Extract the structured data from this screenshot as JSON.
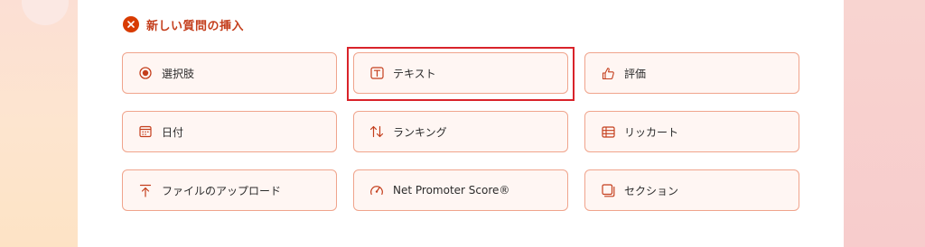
{
  "header": {
    "title": "新しい質問の挿入"
  },
  "options": [
    {
      "label": "選択肢",
      "icon": "radio-choice-icon"
    },
    {
      "label": "テキスト",
      "icon": "text-box-icon"
    },
    {
      "label": "評価",
      "icon": "thumbs-up-icon"
    },
    {
      "label": "日付",
      "icon": "calendar-icon"
    },
    {
      "label": "ランキング",
      "icon": "sort-arrows-icon"
    },
    {
      "label": "リッカート",
      "icon": "likert-grid-icon"
    },
    {
      "label": "ファイルのアップロード",
      "icon": "upload-icon"
    },
    {
      "label": "Net Promoter Score®",
      "icon": "gauge-icon"
    },
    {
      "label": "セクション",
      "icon": "section-icon"
    }
  ],
  "colors": {
    "accent": "#d83b01",
    "title": "#c43e1c",
    "option_border": "#f0a48c",
    "option_bg": "#fff6f3",
    "highlight_border": "#d9232a"
  }
}
